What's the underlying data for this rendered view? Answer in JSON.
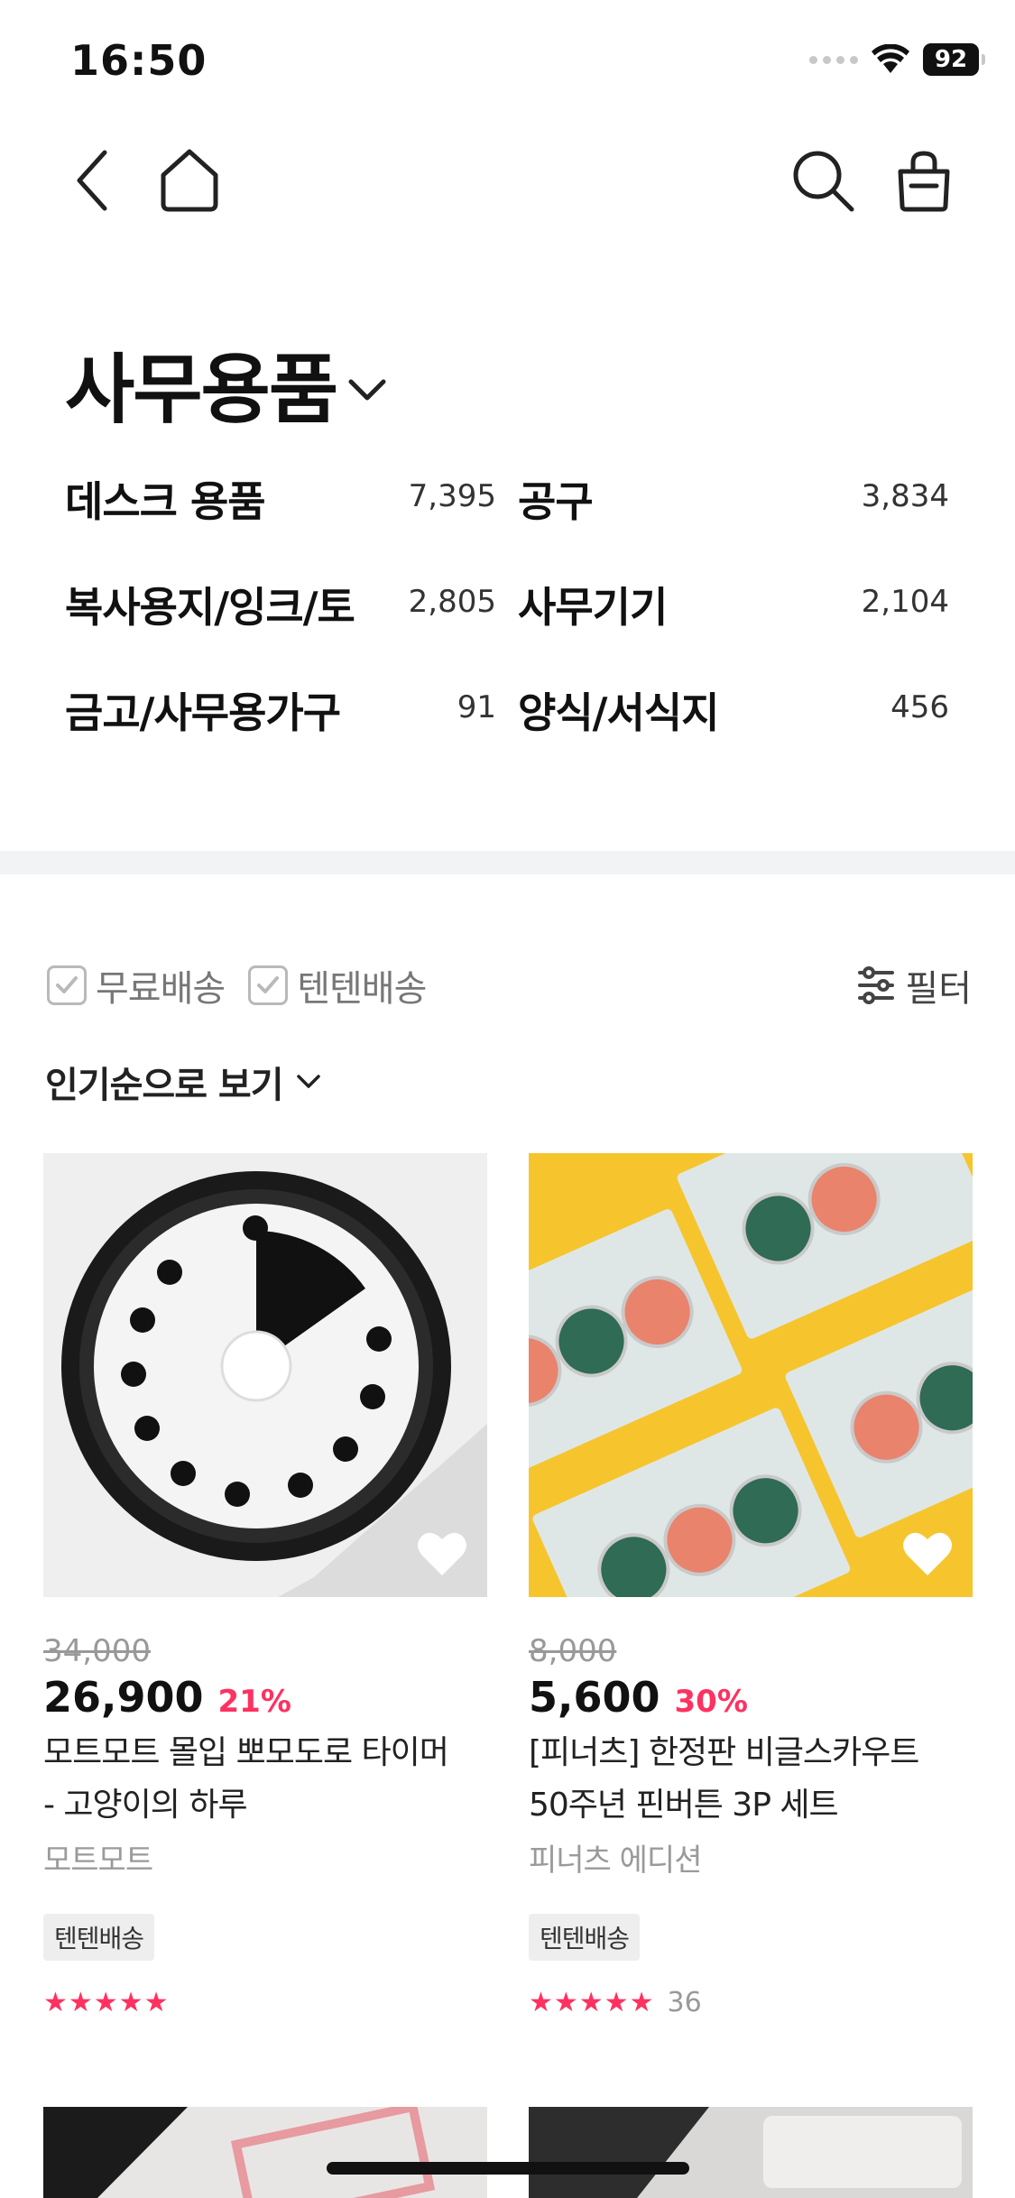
{
  "status": {
    "time": "16:50",
    "battery": "92"
  },
  "category": {
    "title": "사무용품"
  },
  "subcategories": [
    {
      "name": "데스크 용품",
      "count": "7,395"
    },
    {
      "name": "공구",
      "count": "3,834"
    },
    {
      "name": "복사용지/잉크/토",
      "count": "2,805"
    },
    {
      "name": "사무기기",
      "count": "2,104"
    },
    {
      "name": "금고/사무용가구",
      "count": "91"
    },
    {
      "name": "양식/서식지",
      "count": "456"
    }
  ],
  "filters": {
    "free_shipping": "무료배송",
    "tenten_shipping": "텐텐배송",
    "filter_label": "필터"
  },
  "sort": {
    "label": "인기순으로 보기"
  },
  "products": [
    {
      "original_price": "34,000",
      "price": "26,900",
      "discount": "21%",
      "name_line1": "모트모트 몰입 뽀모도로 타이머",
      "name_line2": "- 고양이의 하루",
      "brand": "모트모트",
      "badge": "텐텐배송",
      "stars": "★★★★★",
      "review_count": ""
    },
    {
      "original_price": "8,000",
      "price": "5,600",
      "discount": "30%",
      "name_line1": "[피너츠] 한정판 비글스카우트",
      "name_line2": "50주년 핀버튼 3P 세트",
      "brand": "피너츠 에디션",
      "badge": "텐텐배송",
      "stars": "★★★★★",
      "review_count": "36"
    }
  ],
  "colors": {
    "accent": "#ff3160",
    "divider": "#f2f3f5",
    "badge_bg": "#eeeeee"
  }
}
